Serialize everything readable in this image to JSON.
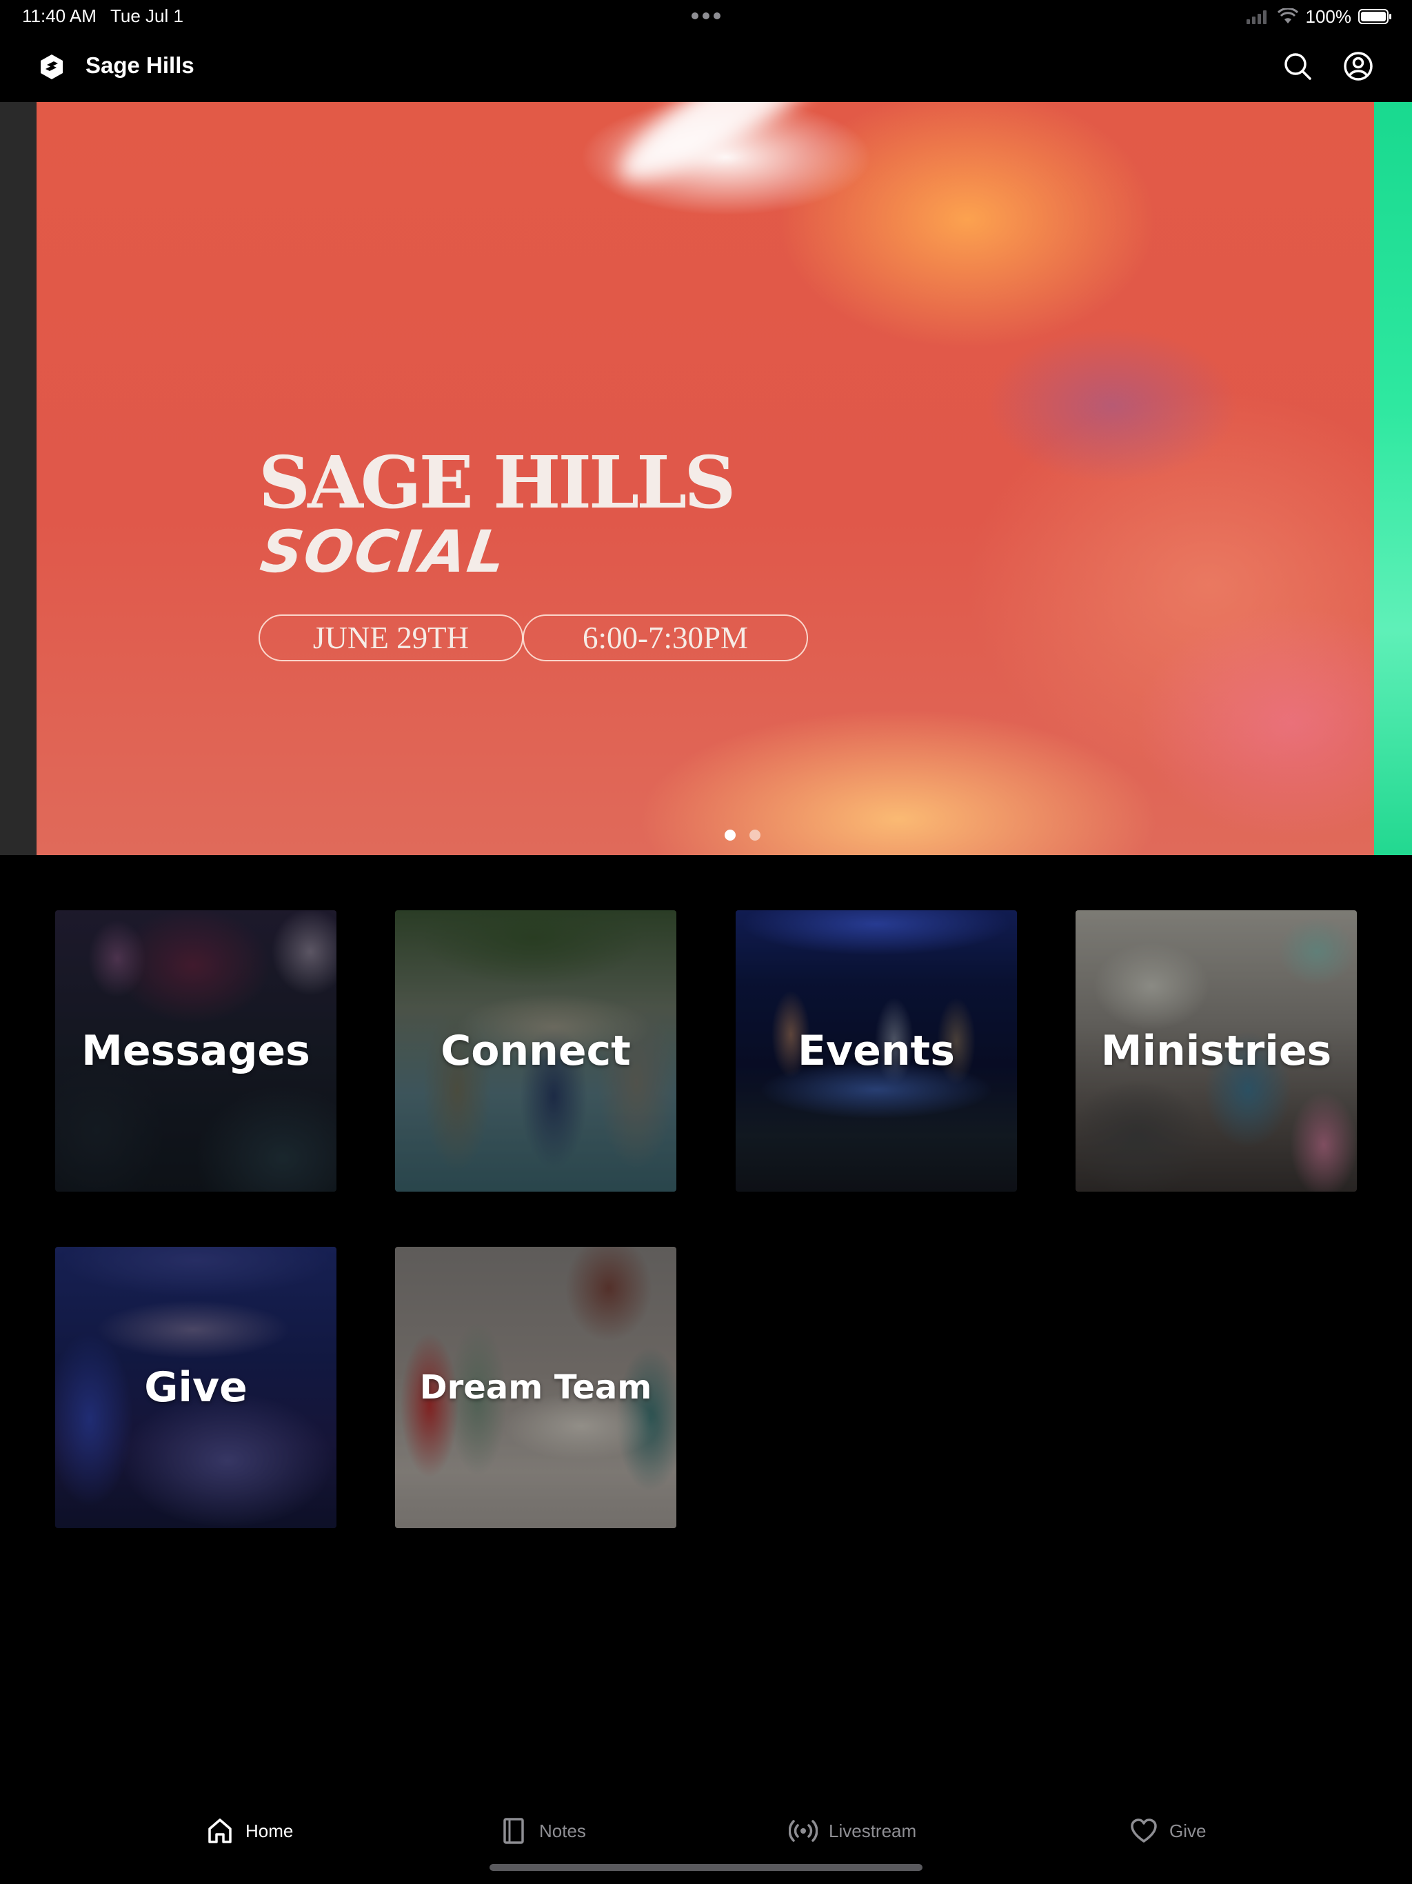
{
  "status_bar": {
    "time": "11:40 AM",
    "date": "Tue Jul 1",
    "battery": "100%"
  },
  "header": {
    "app_title": "Sage Hills"
  },
  "hero": {
    "title_line1": "SAGE HILLS",
    "title_line2": "SOCIAL",
    "date_pill": "JUNE 29TH",
    "time_pill": "6:00-7:30PM",
    "slide_count": 2,
    "active_slide": 1
  },
  "tiles": [
    {
      "label": "Messages"
    },
    {
      "label": "Connect"
    },
    {
      "label": "Events"
    },
    {
      "label": "Ministries"
    },
    {
      "label": "Give"
    },
    {
      "label": "Dream Team"
    }
  ],
  "tab_bar": {
    "items": [
      {
        "label": "Home",
        "icon": "home-icon",
        "active": true
      },
      {
        "label": "Notes",
        "icon": "notes-icon",
        "active": false
      },
      {
        "label": "Livestream",
        "icon": "livestream-icon",
        "active": false
      },
      {
        "label": "Give",
        "icon": "heart-icon",
        "active": false
      }
    ]
  },
  "colors": {
    "background": "#000000",
    "hero_coral": "#e25a47",
    "next_slide_green": "#2ee8a0",
    "inactive_tab": "#8e8e93"
  }
}
